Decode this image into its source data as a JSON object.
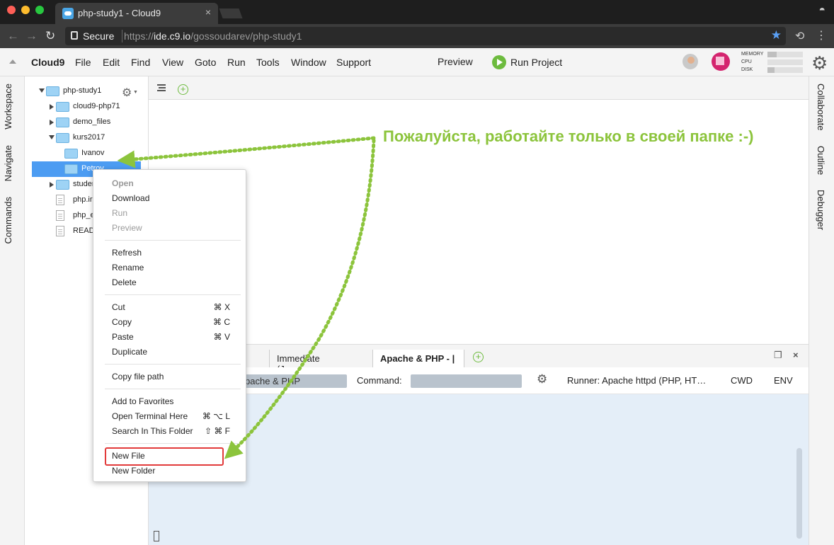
{
  "browser": {
    "tab_title": "php-study1 - Cloud9",
    "tab_close": "×",
    "secure_label": "Secure",
    "url_prefix": "https://",
    "url_host": "ide.c9.io",
    "url_path": "/gossoudarev/php-study1"
  },
  "menubar": {
    "brand": "Cloud9",
    "items": [
      "File",
      "Edit",
      "Find",
      "View",
      "Goto",
      "Run",
      "Tools",
      "Window",
      "Support"
    ],
    "preview": "Preview",
    "run_project": "Run Project",
    "meters": [
      {
        "label": "MEMORY",
        "level": 0.25
      },
      {
        "label": "CPU",
        "level": 0.0
      },
      {
        "label": "DISK",
        "level": 0.2
      }
    ]
  },
  "left_tabs": [
    "Workspace",
    "Navigate",
    "Commands"
  ],
  "right_tabs": [
    "Collaborate",
    "Outline",
    "Debugger"
  ],
  "tree": [
    {
      "label": "php-study1",
      "type": "folder",
      "caret": "down",
      "depth": 0
    },
    {
      "label": "cloud9-php71",
      "type": "folder",
      "caret": "right",
      "depth": 1
    },
    {
      "label": "demo_files",
      "type": "folder",
      "caret": "right",
      "depth": 1
    },
    {
      "label": "kurs2017",
      "type": "folder",
      "caret": "down",
      "depth": 1
    },
    {
      "label": "Ivanov",
      "type": "folder",
      "caret": "none",
      "depth": 2
    },
    {
      "label": "Petrov",
      "type": "folder",
      "caret": "none",
      "depth": 2,
      "selected": true
    },
    {
      "label": "studer",
      "type": "folder",
      "caret": "right",
      "depth": 1
    },
    {
      "label": "php.ir",
      "type": "file",
      "caret": "none",
      "depth": 1
    },
    {
      "label": "php_e",
      "type": "file",
      "caret": "none",
      "depth": 1
    },
    {
      "label": "READ",
      "type": "file",
      "caret": "none",
      "depth": 1
    }
  ],
  "context_menu": {
    "groups": [
      [
        {
          "label": "Open",
          "disabled": true,
          "bold": true
        },
        {
          "label": "Download"
        },
        {
          "label": "Run",
          "disabled": true
        },
        {
          "label": "Preview",
          "disabled": true
        }
      ],
      [
        {
          "label": "Refresh"
        },
        {
          "label": "Rename"
        },
        {
          "label": "Delete"
        }
      ],
      [
        {
          "label": "Cut",
          "shortcut": "⌘ X"
        },
        {
          "label": "Copy",
          "shortcut": "⌘ C"
        },
        {
          "label": "Paste",
          "shortcut": "⌘ V"
        },
        {
          "label": "Duplicate"
        }
      ],
      [
        {
          "label": "Copy file path"
        }
      ],
      [
        {
          "label": "Add to Favorites"
        },
        {
          "label": "Open Terminal Here",
          "shortcut": "⌘ ⌥ L"
        },
        {
          "label": "Search In This Folder",
          "shortcut": "⇧ ⌘ F"
        }
      ],
      [
        {
          "label": "New File",
          "highlighted": true
        },
        {
          "label": "New Folder"
        }
      ]
    ]
  },
  "console": {
    "tabs": [
      {
        "label": "Immediate (Java",
        "active": false
      },
      {
        "label": "Apache & PHP - |",
        "active": true
      }
    ],
    "close_glyph": "×",
    "panel_close": "×",
    "runner_field": "pache & PHP",
    "command_label": "Command:",
    "runner_text": "Runner: Apache httpd (PHP, HT…",
    "cwd": "CWD",
    "env": "ENV"
  },
  "annotation": {
    "text": "Пожалуйста, работайте только в своей папке :-)",
    "color": "#8cc43c"
  },
  "colors": {
    "selection": "#4c9cf2",
    "highlight_box": "#e23a3a",
    "run_green": "#6dbb3e"
  }
}
